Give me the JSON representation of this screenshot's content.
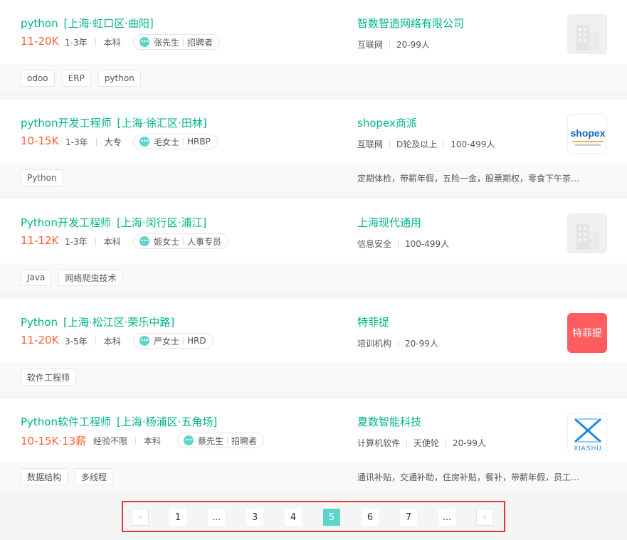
{
  "jobs": [
    {
      "title": "python",
      "location": "[上海·虹口区·曲阳]",
      "salary": "11-20K",
      "experience": "1-3年",
      "education": "本科",
      "recruiter_name": "张先生",
      "recruiter_role": "招聘者",
      "company": "智数智造网络有限公司",
      "industry": "互联网",
      "stage": "",
      "size": "20-99人",
      "logo": "building-placeholder-icon",
      "tags": [
        "odoo",
        "ERP",
        "python"
      ],
      "benefits": ""
    },
    {
      "title": "python开发工程师",
      "location": "[上海·徐汇区·田林]",
      "salary": "10-15K",
      "experience": "1-3年",
      "education": "大专",
      "recruiter_name": "毛女士",
      "recruiter_role": "HRBP",
      "company": "shopex商派",
      "industry": "互联网",
      "stage": "D轮及以上",
      "size": "100-499人",
      "logo": "shopex-logo",
      "logo_text": "shopex",
      "tags": [
        "Python"
      ],
      "benefits": "定期体检，带薪年假，五险一金，股票期权，零食下午茶…"
    },
    {
      "title": "Python开发工程师",
      "location": "[上海·闵行区·浦江]",
      "salary": "11-12K",
      "experience": "1-3年",
      "education": "本科",
      "recruiter_name": "姬女士",
      "recruiter_role": "人事专员",
      "company": "上海现代通用",
      "industry": "信息安全",
      "stage": "",
      "size": "100-499人",
      "logo": "building-placeholder-icon",
      "tags": [
        "Java",
        "网络爬虫技术"
      ],
      "benefits": ""
    },
    {
      "title": "Python",
      "location": "[上海·松江区·荣乐中路]",
      "salary": "11-20K",
      "experience": "3-5年",
      "education": "本科",
      "recruiter_name": "严女士",
      "recruiter_role": "HRD",
      "company": "特菲提",
      "industry": "培训机构",
      "stage": "",
      "size": "20-99人",
      "logo": "tefeiti-logo",
      "logo_text": "特菲提",
      "tags": [
        "软件工程师"
      ],
      "benefits": ""
    },
    {
      "title": "Python软件工程师",
      "location": "[上海·杨浦区·五角场]",
      "salary": "10-15K·13薪",
      "experience": "经验不限",
      "education": "本科",
      "recruiter_name": "蔡先生",
      "recruiter_role": "招聘者",
      "company": "夏数智能科技",
      "industry": "计算机软件",
      "stage": "天使轮",
      "size": "20-99人",
      "logo": "xiashu-logo",
      "logo_text": "XIASHU",
      "tags": [
        "数据结构",
        "多线程"
      ],
      "benefits": "通讯补贴，交通补助，住房补贴，餐补，带薪年假，员工…"
    }
  ],
  "pagination": {
    "prev_icon": "chevron-left-icon",
    "next_icon": "chevron-right-icon",
    "pages": [
      "1",
      "...",
      "3",
      "4",
      "5",
      "6",
      "7",
      "..."
    ],
    "current": "5"
  },
  "colors": {
    "accent": "#00b38a",
    "salary": "#fd5f39",
    "page_active": "#5dd5c8",
    "highlight_border": "#e53935"
  }
}
